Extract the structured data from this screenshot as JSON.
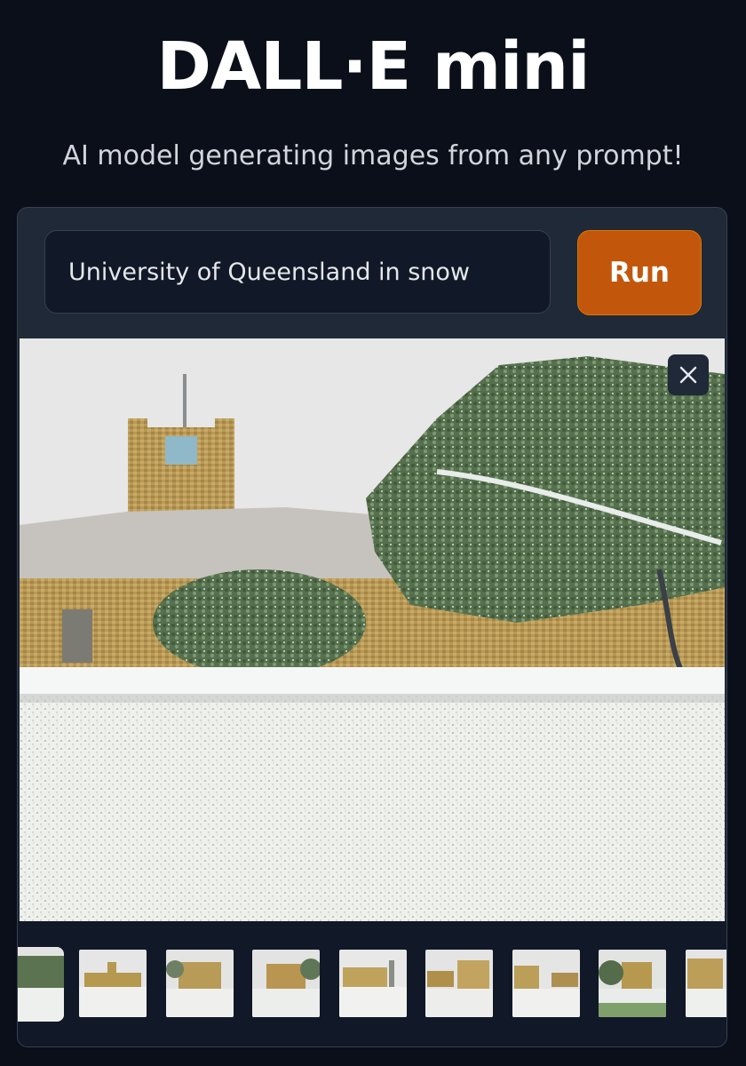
{
  "header": {
    "title": "DALL·E mini",
    "subtitle": "AI model generating images from any prompt!"
  },
  "prompt": {
    "value": "University of Queensland in snow"
  },
  "run_button": {
    "label": "Run"
  },
  "gallery": {
    "selected_index": 0,
    "thumbnail_count": 9
  },
  "colors": {
    "background": "#0b0f19",
    "panel": "#1f2937",
    "accent": "#c2570c"
  }
}
